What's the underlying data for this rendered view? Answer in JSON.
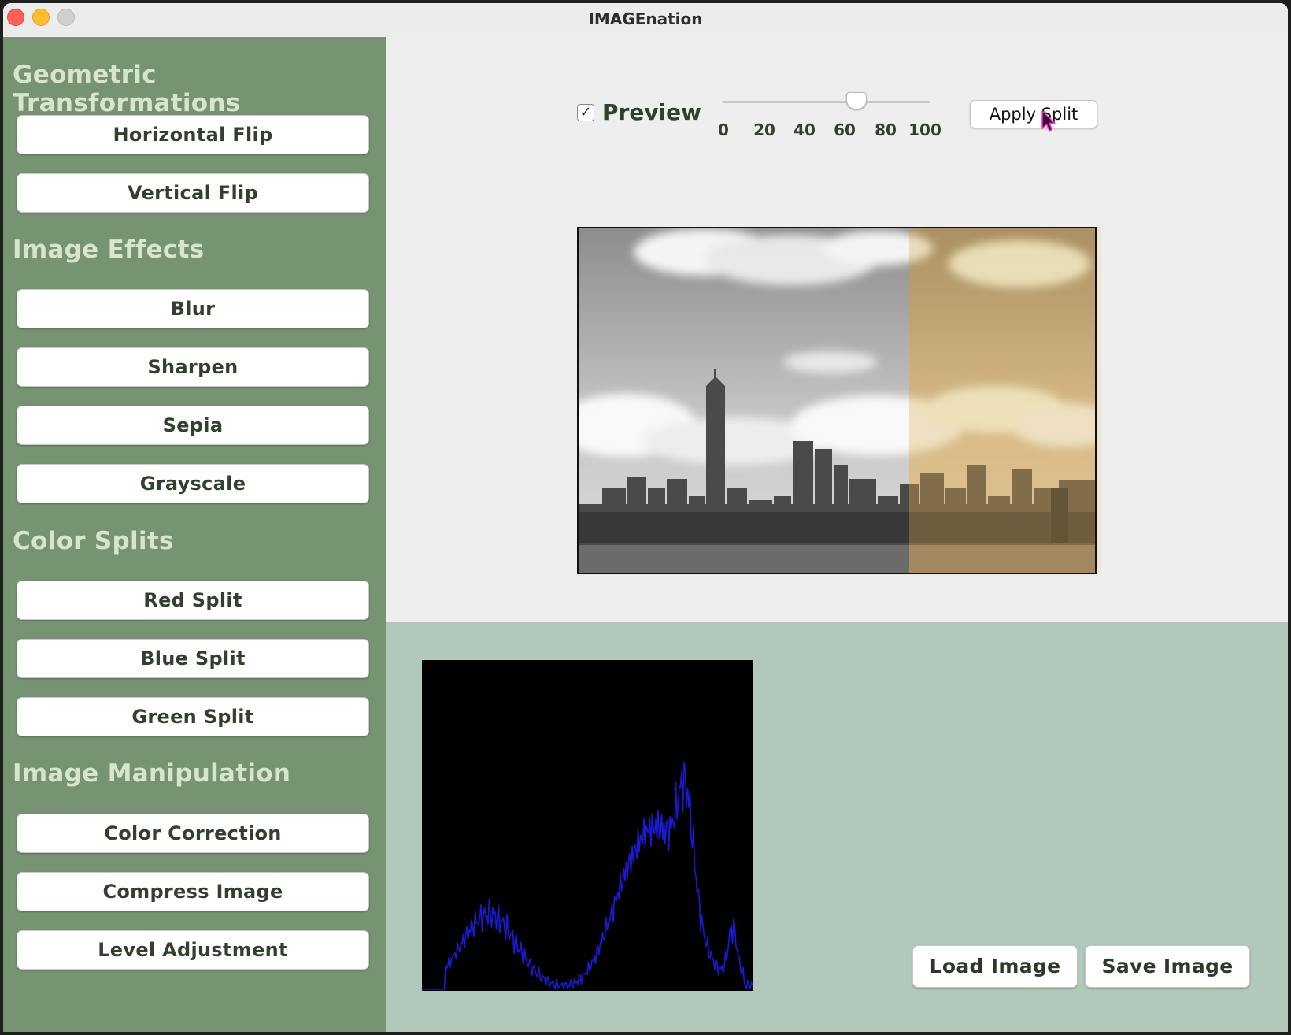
{
  "window": {
    "title": "IMAGEnation"
  },
  "sidebar": {
    "sections": [
      {
        "title": "Geometric Transformations",
        "buttons": [
          "Horizontal Flip",
          "Vertical Flip"
        ]
      },
      {
        "title": "Image Effects",
        "buttons": [
          "Blur",
          "Sharpen",
          "Sepia",
          "Grayscale"
        ]
      },
      {
        "title": "Color Splits",
        "buttons": [
          "Red Split",
          "Blue Split",
          "Green Split"
        ]
      },
      {
        "title": "Image Manipulation",
        "buttons": [
          "Color Correction",
          "Compress Image",
          "Level Adjustment"
        ]
      }
    ]
  },
  "toolbar": {
    "preview_label": "Preview",
    "preview_checked": true,
    "checkmark": "✓",
    "slider": {
      "ticks": [
        "0",
        "20",
        "40",
        "60",
        "80",
        "100"
      ],
      "value": 64,
      "min": 0,
      "max": 100
    },
    "apply_label": "Apply Split"
  },
  "preview_image": {
    "split_fraction": 0.64,
    "left_effect": "grayscale",
    "right_effect": "sepia"
  },
  "histogram": {
    "line_color": "#1a1ad2",
    "background": "#000000"
  },
  "footer": {
    "load_label": "Load Image",
    "save_label": "Save Image"
  },
  "colors": {
    "sidebar": "#769372",
    "section_title": "#d6e5cc",
    "bottom_panel": "#b1c8bb"
  }
}
